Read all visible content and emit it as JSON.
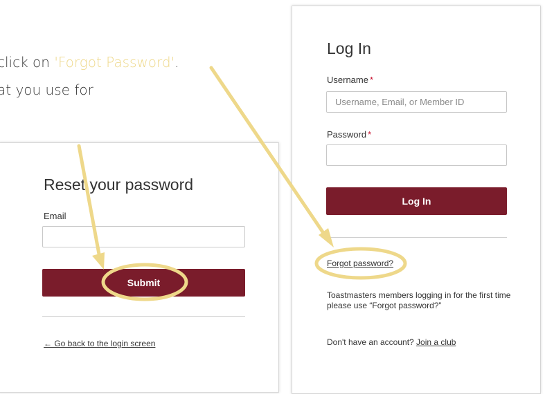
{
  "instructions": {
    "line1_prefix": "click on ",
    "line1_highlight": "'Forgot Password'",
    "line1_suffix": ".",
    "line2": "at you use for"
  },
  "reset_panel": {
    "title": "Reset your password",
    "email_label": "Email",
    "email_value": "",
    "submit_label": "Submit",
    "back_link": "← Go back to the login screen"
  },
  "login_panel": {
    "title": "Log In",
    "username_label": "Username",
    "username_placeholder": "Username, Email, or Member ID",
    "password_label": "Password",
    "password_value": "",
    "required_marker": "*",
    "login_button": "Log In",
    "forgot_link": "Forgot password?",
    "first_time_note": "Toastmasters members logging in for the first time please use “Forgot password?”",
    "no_account_prefix": "Don't have an account? ",
    "join_link": "Join a club"
  },
  "colors": {
    "button": "#7a1c2b",
    "annotation": "#eed88a",
    "required": "#c8102e"
  }
}
